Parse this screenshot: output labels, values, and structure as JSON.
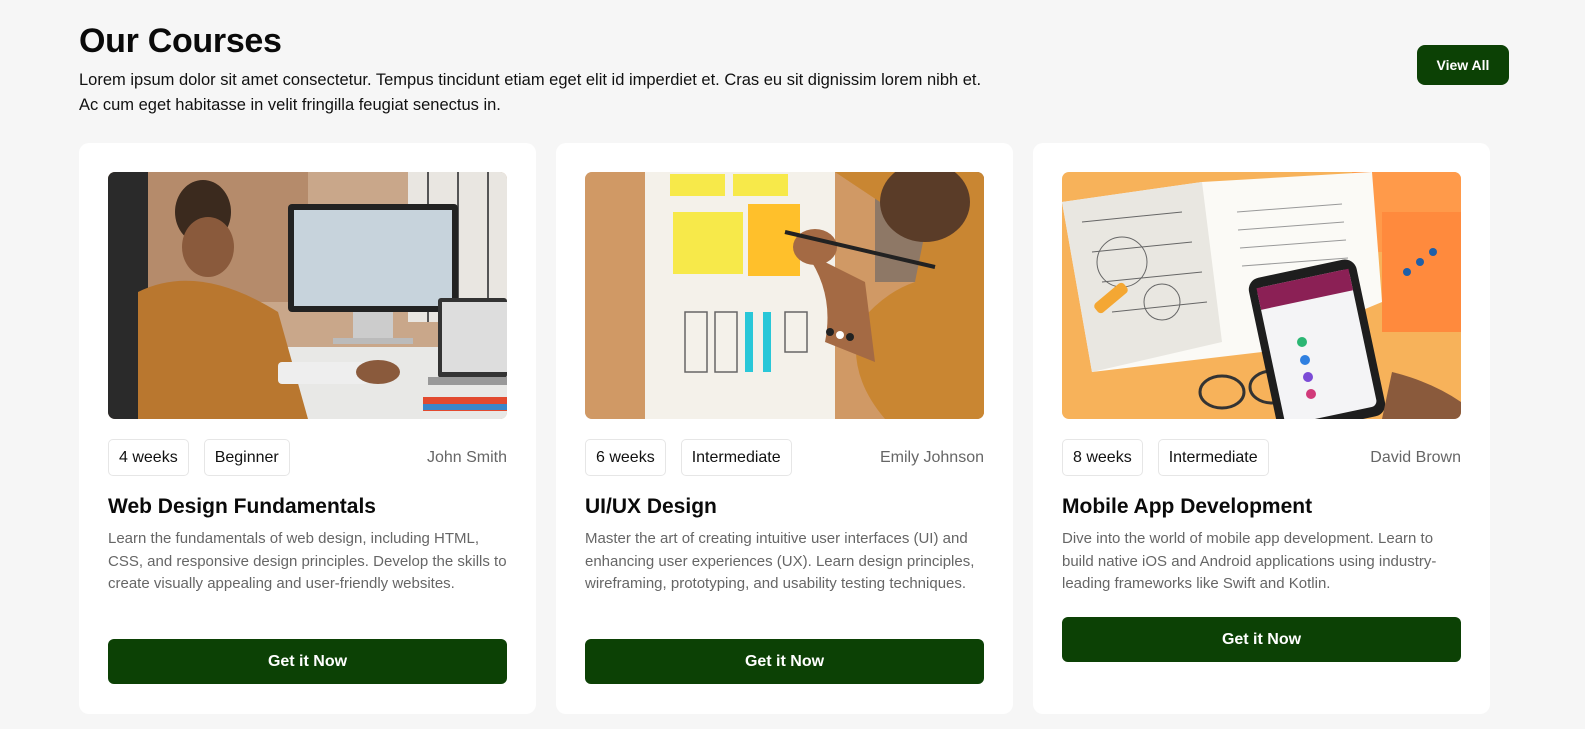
{
  "section": {
    "title": "Our Courses",
    "subtitle_line1": "Lorem ipsum dolor sit amet consectetur. Tempus tincidunt etiam eget elit id imperdiet et. Cras eu sit dignissim lorem nibh et.",
    "subtitle_line2": "Ac cum eget habitasse in velit fringilla feugiat senectus in.",
    "view_all_label": "View All"
  },
  "colors": {
    "accent": "#0c4105",
    "background": "#f6f6f6",
    "card": "#ffffff",
    "muted_text": "#666666"
  },
  "courses": [
    {
      "duration": "4 weeks",
      "level": "Beginner",
      "instructor": "John Smith",
      "title": "Web Design Fundamentals",
      "description": "Learn the fundamentals of web design, including HTML, CSS, and responsive design principles. Develop the skills to create visually appealing and user-friendly websites.",
      "cta_label": "Get it Now",
      "image_icon": "person-at-desktop-computer-photo"
    },
    {
      "duration": "6 weeks",
      "level": "Intermediate",
      "instructor": "Emily Johnson",
      "title": "UI/UX Design",
      "description": "Master the art of creating intuitive user interfaces (UI) and enhancing user experiences (UX). Learn design principles, wireframing, prototyping, and usability testing techniques.",
      "cta_label": "Get it Now",
      "image_icon": "wireframe-sketching-photo"
    },
    {
      "duration": "8 weeks",
      "level": "Intermediate",
      "instructor": "David Brown",
      "title": "Mobile App Development",
      "description": "Dive into the world of mobile app development. Learn to build native iOS and Android applications using industry-leading frameworks like Swift and Kotlin.",
      "cta_label": "Get it Now",
      "image_icon": "smartphone-and-notebook-photo"
    }
  ]
}
